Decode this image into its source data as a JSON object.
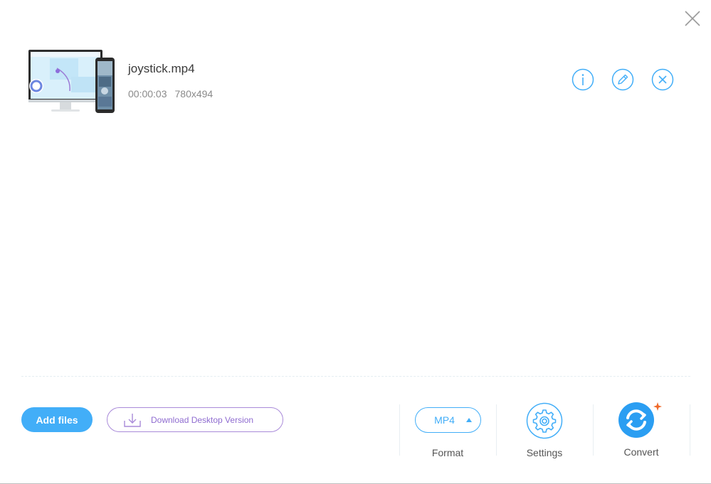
{
  "file": {
    "name": "joystick.mp4",
    "duration": "00:00:03",
    "resolution": "780x494"
  },
  "actions": {
    "add_files": "Add files",
    "download_desktop": "Download Desktop Version"
  },
  "tools": {
    "format_value": "MP4",
    "format_label": "Format",
    "settings_label": "Settings",
    "convert_label": "Convert"
  },
  "icons": {
    "close": "close-icon",
    "info": "info-icon",
    "edit": "pencil-icon",
    "remove": "remove-icon",
    "download": "download-icon",
    "settings": "gear-icon",
    "convert": "convert-icon"
  },
  "colors": {
    "accent": "#42aef8",
    "download_border": "#a98ad9",
    "download_text": "#8f6cd0",
    "spark": "#f06a2a"
  }
}
